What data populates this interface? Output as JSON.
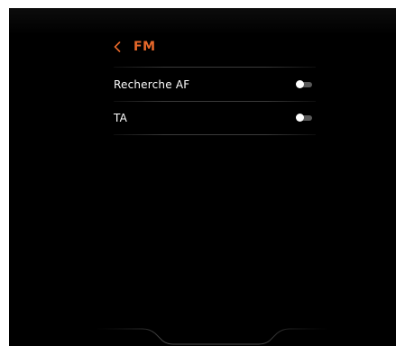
{
  "header": {
    "back_icon": "chevron-left-icon",
    "title": "FM"
  },
  "settings": [
    {
      "label": "Recherche AF",
      "toggle_on": false
    },
    {
      "label": "TA",
      "toggle_on": false
    }
  ],
  "colors": {
    "background": "#000000",
    "accent": "#e8682a",
    "text": "#ffffff",
    "divider": "#3a3a3a",
    "toggle_track": "#5a5a5a"
  }
}
